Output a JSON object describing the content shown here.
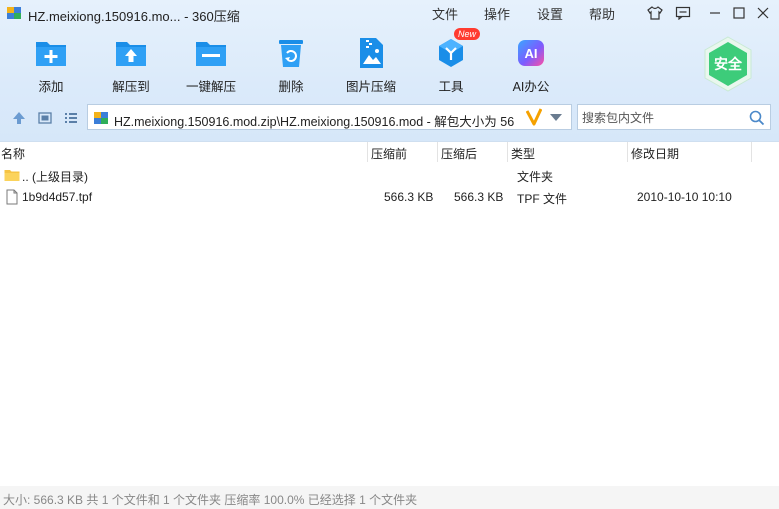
{
  "window": {
    "title": "HZ.meixiong.150916.mo... - 360压缩",
    "menus": [
      "文件",
      "操作",
      "设置",
      "帮助"
    ]
  },
  "toolbar": {
    "items": [
      {
        "label": "添加",
        "icon": "add-icon"
      },
      {
        "label": "解压到",
        "icon": "extract-to-icon"
      },
      {
        "label": "一键解压",
        "icon": "one-click-extract-icon"
      },
      {
        "label": "删除",
        "icon": "delete-icon"
      },
      {
        "label": "图片压缩",
        "icon": "image-compress-icon"
      },
      {
        "label": "工具",
        "icon": "tools-icon",
        "badge": "New"
      },
      {
        "label": "AI办公",
        "icon": "ai-office-icon",
        "icon_text": "AI"
      }
    ],
    "safe_label": "安全"
  },
  "address": {
    "path": "HZ.meixiong.150916.mod.zip\\HZ.meixiong.150916.mod - 解包大小为 56"
  },
  "search": {
    "placeholder": "搜索包内文件"
  },
  "list": {
    "columns": [
      "名称",
      "压缩前",
      "压缩后",
      "类型",
      "修改日期"
    ],
    "rows": [
      {
        "name": ".. (上级目录)",
        "before": "",
        "after": "",
        "type": "文件夹",
        "modified": "",
        "icon": "folder-icon"
      },
      {
        "name": "1b9d4d57.tpf",
        "before": "566.3 KB",
        "after": "566.3 KB",
        "type": "TPF 文件",
        "modified": "2010-10-10 10:10",
        "icon": "file-icon"
      }
    ]
  },
  "status": {
    "text": "大小: 566.3 KB 共 1 个文件和 1 个文件夹 压缩率 100.0% 已经选择 1 个文件夹"
  },
  "colors": {
    "accent_blue": "#1a8ee8",
    "safe_green": "#3dcc7a",
    "badge_red": "#ff3b30",
    "header_bg": "#dbeafa"
  }
}
